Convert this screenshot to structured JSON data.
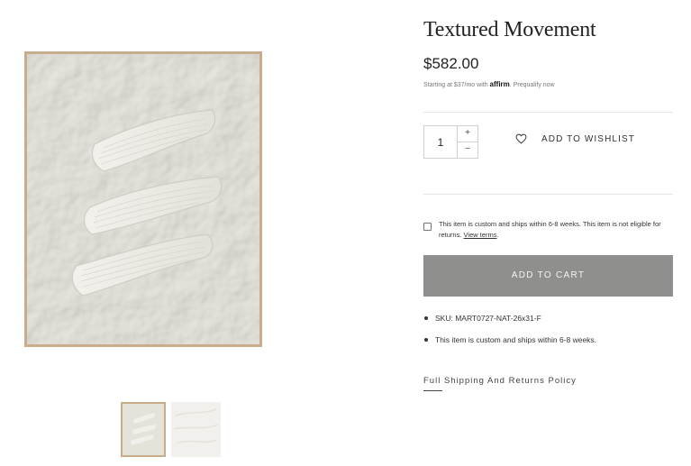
{
  "product": {
    "title": "Textured Movement",
    "price": "$582.00",
    "affirm": {
      "prefix": "Starting at $37/mo with",
      "brand": "affirm",
      "link": "Prequalify now"
    }
  },
  "quantity": {
    "value": "1",
    "plus_label": "+",
    "minus_label": "−"
  },
  "wishlist": {
    "label": "ADD TO WISHLIST",
    "icon": "heart-outline-icon"
  },
  "terms": {
    "text": "This item is custom and ships within 6-8 weeks. This item is not eligible for returns.",
    "link": "View terms",
    "checked": false
  },
  "cart": {
    "label": "ADD TO CART",
    "button_color": "#8f8f8d"
  },
  "details": [
    "SKU: MART0727-NAT-26x31-F",
    "This item is custom and ships within 6-8 weeks."
  ],
  "policy_link": "Full Shipping And Returns Policy",
  "gallery": {
    "thumbnail_count": 2,
    "frame_color": "#c9ad8a",
    "canvas_color": "#e4e3da"
  }
}
